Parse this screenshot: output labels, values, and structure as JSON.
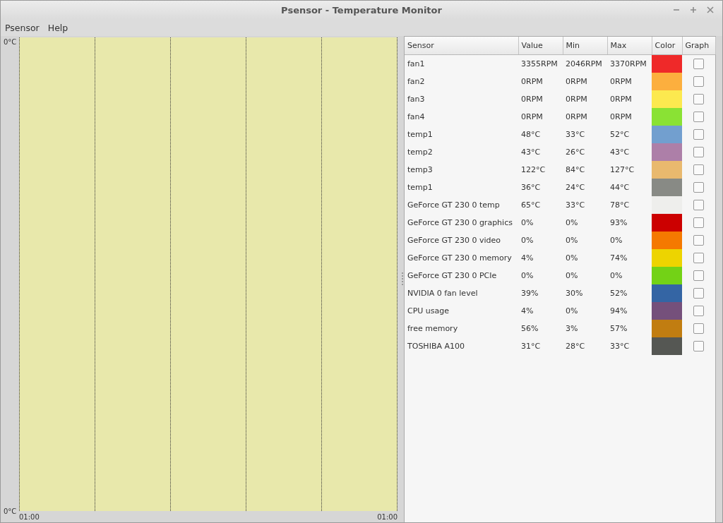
{
  "window": {
    "title": "Psensor - Temperature Monitor"
  },
  "menu": [
    "Psensor",
    "Help"
  ],
  "graph": {
    "y_top": "0°C",
    "y_bottom": "0°C",
    "x_start": "01:00",
    "x_end": "01:00"
  },
  "table": {
    "columns": [
      "Sensor",
      "Value",
      "Min",
      "Max",
      "Color",
      "Graph"
    ],
    "rows": [
      {
        "sensor": "fan1",
        "value": "3355RPM",
        "min": "2046RPM",
        "max": "3370RPM",
        "color": "#ef2929",
        "graph": false
      },
      {
        "sensor": "fan2",
        "value": "0RPM",
        "min": "0RPM",
        "max": "0RPM",
        "color": "#fcaf3e",
        "graph": false
      },
      {
        "sensor": "fan3",
        "value": "0RPM",
        "min": "0RPM",
        "max": "0RPM",
        "color": "#fce94f",
        "graph": false
      },
      {
        "sensor": "fan4",
        "value": "0RPM",
        "min": "0RPM",
        "max": "0RPM",
        "color": "#8ae234",
        "graph": false
      },
      {
        "sensor": "temp1",
        "value": "48°C",
        "min": "33°C",
        "max": "52°C",
        "color": "#729fcf",
        "graph": false
      },
      {
        "sensor": "temp2",
        "value": "43°C",
        "min": "26°C",
        "max": "43°C",
        "color": "#ad7fa8",
        "graph": false
      },
      {
        "sensor": "temp3",
        "value": "122°C",
        "min": "84°C",
        "max": "127°C",
        "color": "#e9b96e",
        "graph": false
      },
      {
        "sensor": "temp1",
        "value": "36°C",
        "min": "24°C",
        "max": "44°C",
        "color": "#888a85",
        "graph": false
      },
      {
        "sensor": "GeForce GT 230 0 temp",
        "value": "65°C",
        "min": "33°C",
        "max": "78°C",
        "color": "#eeeeec",
        "graph": false
      },
      {
        "sensor": "GeForce GT 230 0 graphics",
        "value": "0%",
        "min": "0%",
        "max": "93%",
        "color": "#cc0000",
        "graph": false
      },
      {
        "sensor": "GeForce GT 230 0 video",
        "value": "0%",
        "min": "0%",
        "max": "0%",
        "color": "#f57900",
        "graph": false
      },
      {
        "sensor": "GeForce GT 230 0 memory",
        "value": "4%",
        "min": "0%",
        "max": "74%",
        "color": "#edd400",
        "graph": false
      },
      {
        "sensor": "GeForce GT 230 0 PCIe",
        "value": "0%",
        "min": "0%",
        "max": "0%",
        "color": "#73d216",
        "graph": false
      },
      {
        "sensor": "NVIDIA 0 fan level",
        "value": "39%",
        "min": "30%",
        "max": "52%",
        "color": "#3465a4",
        "graph": false
      },
      {
        "sensor": "CPU usage",
        "value": "4%",
        "min": "0%",
        "max": "94%",
        "color": "#75507b",
        "graph": false
      },
      {
        "sensor": "free memory",
        "value": "56%",
        "min": "3%",
        "max": "57%",
        "color": "#c17d11",
        "graph": false
      },
      {
        "sensor": "TOSHIBA A100",
        "value": "31°C",
        "min": "28°C",
        "max": "33°C",
        "color": "#555753",
        "graph": false
      }
    ]
  }
}
